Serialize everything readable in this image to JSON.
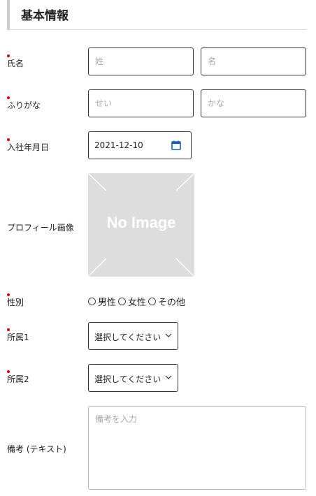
{
  "section": {
    "title": "基本情報"
  },
  "fields": {
    "name": {
      "label": "氏名",
      "last_placeholder": "姓",
      "first_placeholder": "名"
    },
    "kana": {
      "label": "ふりがな",
      "last_placeholder": "せい",
      "first_placeholder": "かな"
    },
    "hire_date": {
      "label": "入社年月日",
      "value": "2021-12-10"
    },
    "profile_image": {
      "label": "プロフィール画像",
      "placeholder_text": "No Image"
    },
    "gender": {
      "label": "性別",
      "options": [
        "男性",
        "女性",
        "その他"
      ]
    },
    "dept1": {
      "label": "所属1",
      "selected": "選択してください"
    },
    "dept2": {
      "label": "所属2",
      "selected": "選択してください"
    },
    "notes": {
      "label": "備考 (テキスト)",
      "placeholder": "備考を入力"
    }
  },
  "colors": {
    "required": "#e00000",
    "border": "#333333",
    "image_bg": "#dddddd",
    "calendar_icon": "#1a5fb4"
  }
}
